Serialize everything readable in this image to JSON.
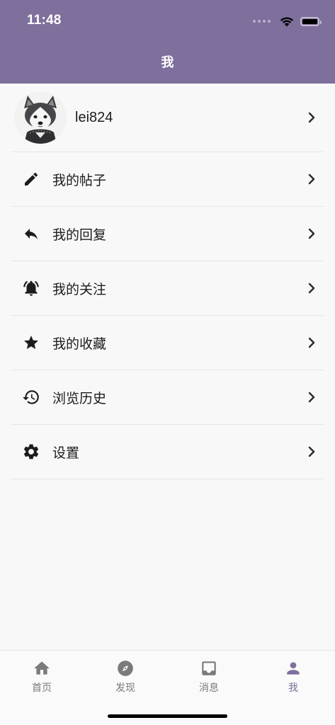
{
  "status_bar": {
    "time": "11:48"
  },
  "header": {
    "title": "我",
    "color": "#7e6f9c"
  },
  "profile": {
    "username": "lei824"
  },
  "menu": [
    {
      "label": "我的帖子",
      "icon": "pencil-icon"
    },
    {
      "label": "我的回复",
      "icon": "reply-icon"
    },
    {
      "label": "我的关注",
      "icon": "bell-icon"
    },
    {
      "label": "我的收藏",
      "icon": "star-icon"
    },
    {
      "label": "浏览历史",
      "icon": "history-icon"
    },
    {
      "label": "设置",
      "icon": "gear-icon"
    }
  ],
  "tabbar": {
    "tabs": [
      {
        "label": "首页",
        "icon": "home-icon"
      },
      {
        "label": "发现",
        "icon": "compass-icon"
      },
      {
        "label": "消息",
        "icon": "inbox-icon"
      },
      {
        "label": "我",
        "icon": "person-icon",
        "active": true
      }
    ],
    "active_color": "#7e6f9c",
    "inactive_color": "#7a7a7a"
  }
}
